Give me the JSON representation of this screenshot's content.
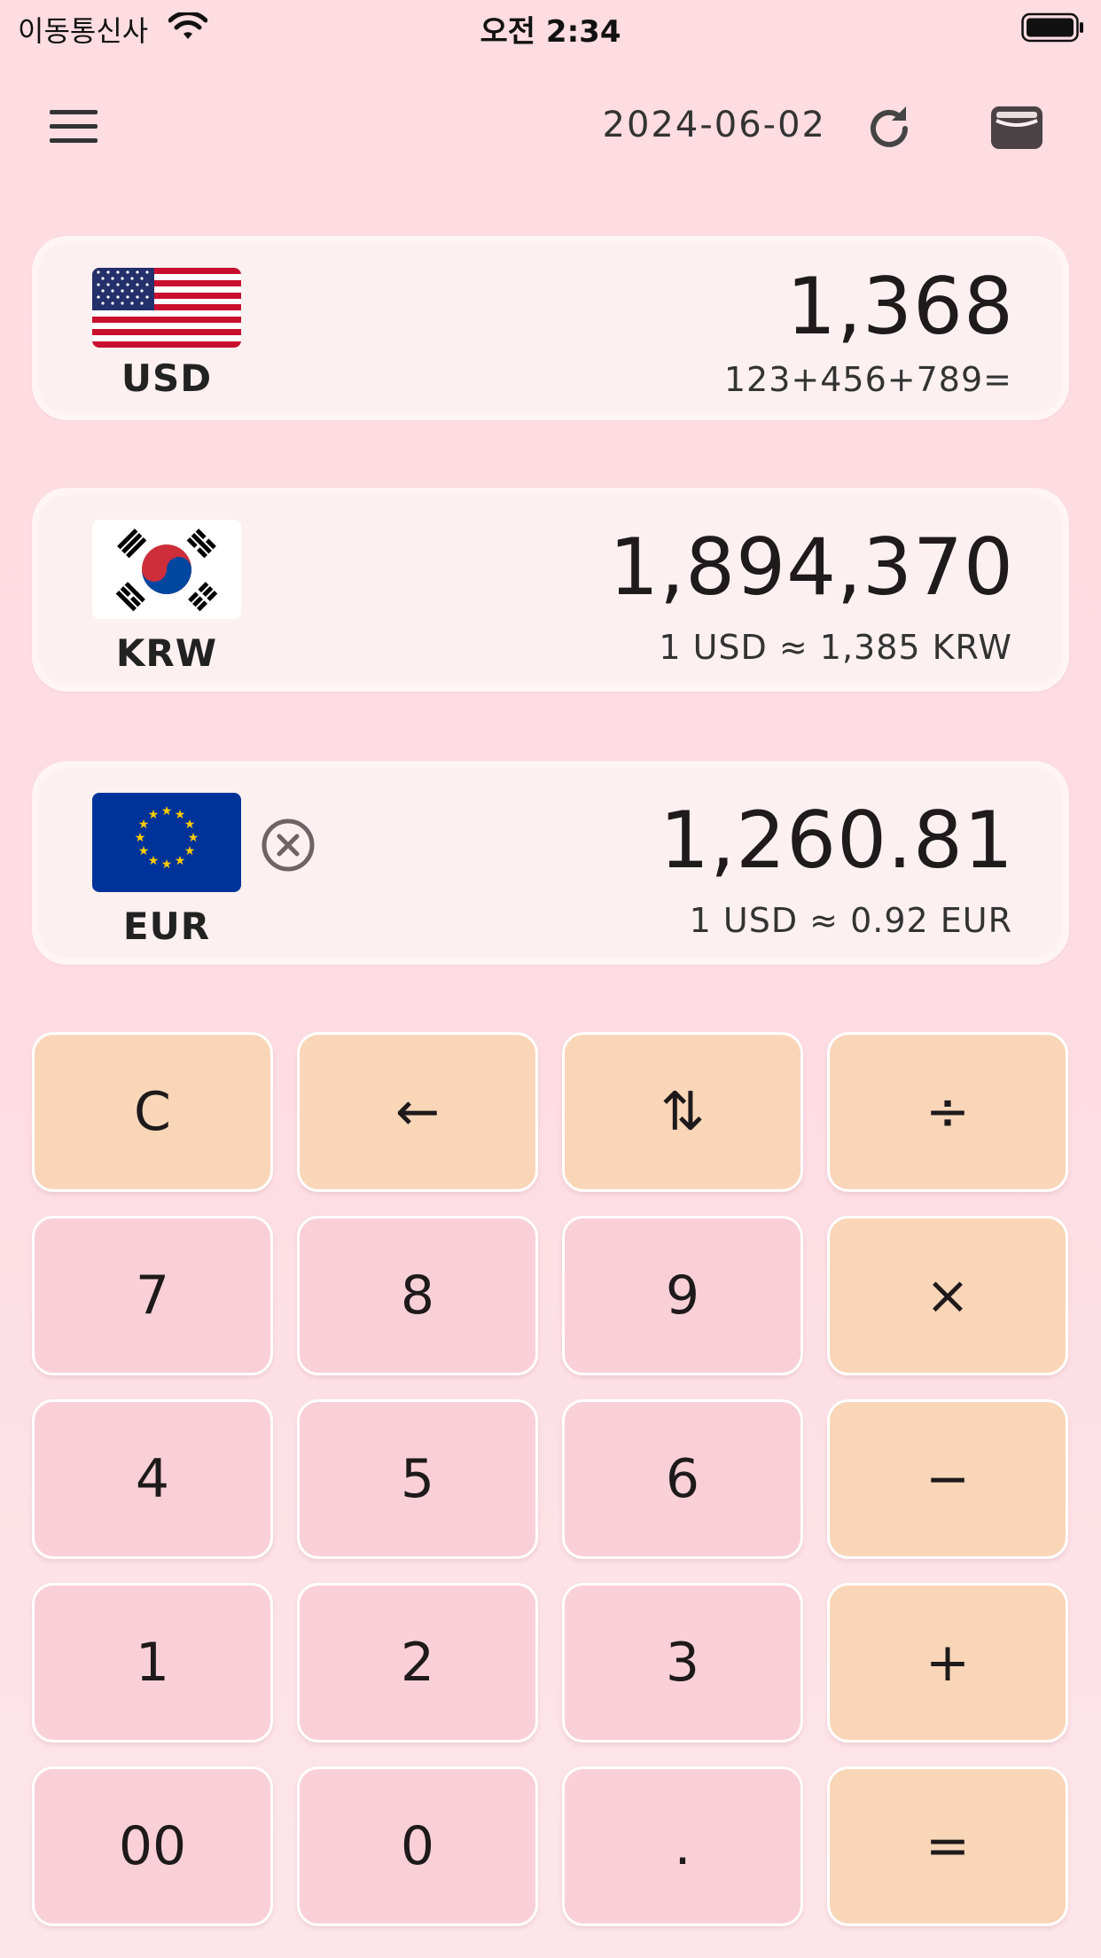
{
  "status_bar": {
    "carrier": "이동통신사",
    "time": "오전 2:34",
    "icons": [
      "wifi-icon",
      "battery-icon"
    ]
  },
  "toolbar": {
    "menu_icon": "menu-icon",
    "date": "2024-06-02",
    "refresh_icon": "refresh-icon",
    "wallet_icon": "wallet-icon"
  },
  "currencies": [
    {
      "code": "USD",
      "flag": "us-flag-icon",
      "amount": "1,368",
      "expression": "123+456+789="
    },
    {
      "code": "KRW",
      "flag": "kr-flag-icon",
      "amount": "1,894,370",
      "rate": "1 USD ≈ 1,385 KRW"
    },
    {
      "code": "EUR",
      "flag": "eu-flag-icon",
      "amount": "1,260.81",
      "rate": "1 USD ≈ 0.92 EUR",
      "remove_icon": "close-circle-icon"
    }
  ],
  "keypad": {
    "rows": [
      [
        {
          "label": "C",
          "kind": "op"
        },
        {
          "label": "←",
          "kind": "op"
        },
        {
          "label": "⇅",
          "kind": "op"
        },
        {
          "label": "÷",
          "kind": "op"
        }
      ],
      [
        {
          "label": "7",
          "kind": "num"
        },
        {
          "label": "8",
          "kind": "num"
        },
        {
          "label": "9",
          "kind": "num"
        },
        {
          "label": "×",
          "kind": "op"
        }
      ],
      [
        {
          "label": "4",
          "kind": "num"
        },
        {
          "label": "5",
          "kind": "num"
        },
        {
          "label": "6",
          "kind": "num"
        },
        {
          "label": "−",
          "kind": "op"
        }
      ],
      [
        {
          "label": "1",
          "kind": "num"
        },
        {
          "label": "2",
          "kind": "num"
        },
        {
          "label": "3",
          "kind": "num"
        },
        {
          "label": "+",
          "kind": "op"
        }
      ],
      [
        {
          "label": "00",
          "kind": "num"
        },
        {
          "label": "0",
          "kind": "num"
        },
        {
          "label": ".",
          "kind": "num"
        },
        {
          "label": "=",
          "kind": "op"
        }
      ]
    ]
  },
  "colors": {
    "background": "#fddce2",
    "card": "#fdf0f1",
    "operator_key": "#f9d6b8",
    "number_key": "#f9d0d8"
  }
}
